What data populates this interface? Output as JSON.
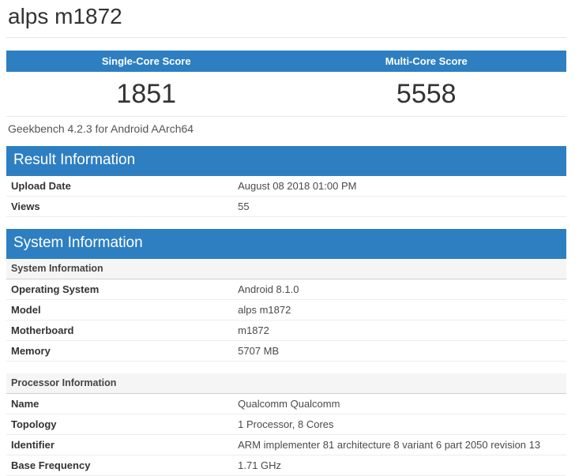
{
  "colors": {
    "accent_blue": "#2e7fc1",
    "subheader_bg": "#f5f5f5"
  },
  "page": {
    "title": "alps m1872"
  },
  "scores": {
    "columns": [
      {
        "label": "Single-Core Score",
        "value": "1851"
      },
      {
        "label": "Multi-Core Score",
        "value": "5558"
      }
    ],
    "caption": "Geekbench 4.2.3 for Android AArch64"
  },
  "result_information": {
    "heading": "Result Information",
    "rows": [
      {
        "label": "Upload Date",
        "value": "August 08 2018 01:00 PM"
      },
      {
        "label": "Views",
        "value": "55"
      }
    ]
  },
  "system_information": {
    "heading": "System Information",
    "sections": [
      {
        "subheading": "System Information",
        "rows": [
          {
            "label": "Operating System",
            "value": "Android 8.1.0"
          },
          {
            "label": "Model",
            "value": "alps m1872"
          },
          {
            "label": "Motherboard",
            "value": "m1872"
          },
          {
            "label": "Memory",
            "value": "5707 MB"
          }
        ]
      },
      {
        "subheading": "Processor Information",
        "rows": [
          {
            "label": "Name",
            "value": "Qualcomm Qualcomm"
          },
          {
            "label": "Topology",
            "value": "1 Processor, 8 Cores"
          },
          {
            "label": "Identifier",
            "value": "ARM implementer 81 architecture 8 variant 6 part 2050 revision 13"
          },
          {
            "label": "Base Frequency",
            "value": "1.71 GHz"
          }
        ]
      }
    ]
  }
}
